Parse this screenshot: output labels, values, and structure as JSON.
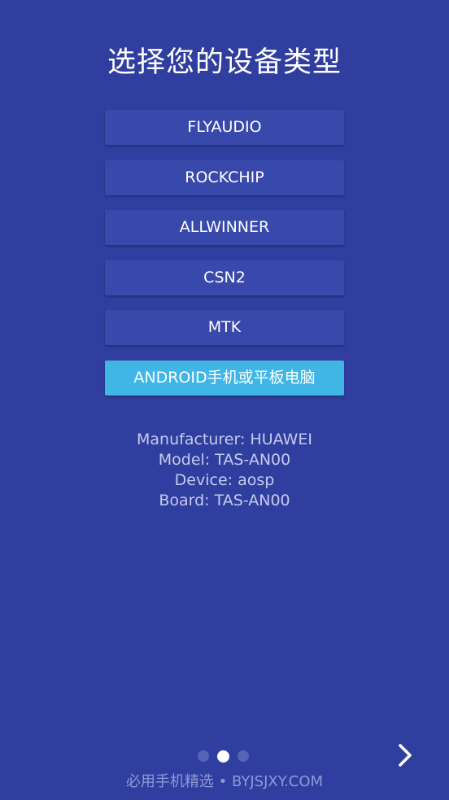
{
  "title": "选择您的设备类型",
  "options": [
    {
      "label": "FLYAUDIO"
    },
    {
      "label": "ROCKCHIP"
    },
    {
      "label": "ALLWINNER"
    },
    {
      "label": "CSN2"
    },
    {
      "label": "MTK"
    },
    {
      "label": "ANDROID手机或平板电脑"
    }
  ],
  "selected_option": "ANDROID手机或平板电脑",
  "device_info": {
    "manufacturer": "Manufacturer: HUAWEI",
    "model": "Model: TAS-AN00",
    "device": "Device: aosp",
    "board": "Board: TAS-AN00"
  },
  "pager": {
    "total_pages": 3,
    "current_page": 2
  },
  "next_icon": "chevron-right-icon",
  "footer": "必用手机精选 • BYJSJXY.COM",
  "colors": {
    "background": "#303f9f",
    "button": "#3949ab",
    "button_selected": "#40b6e6",
    "info_text": "#c5cbec",
    "footer_text": "#8f99d6"
  }
}
